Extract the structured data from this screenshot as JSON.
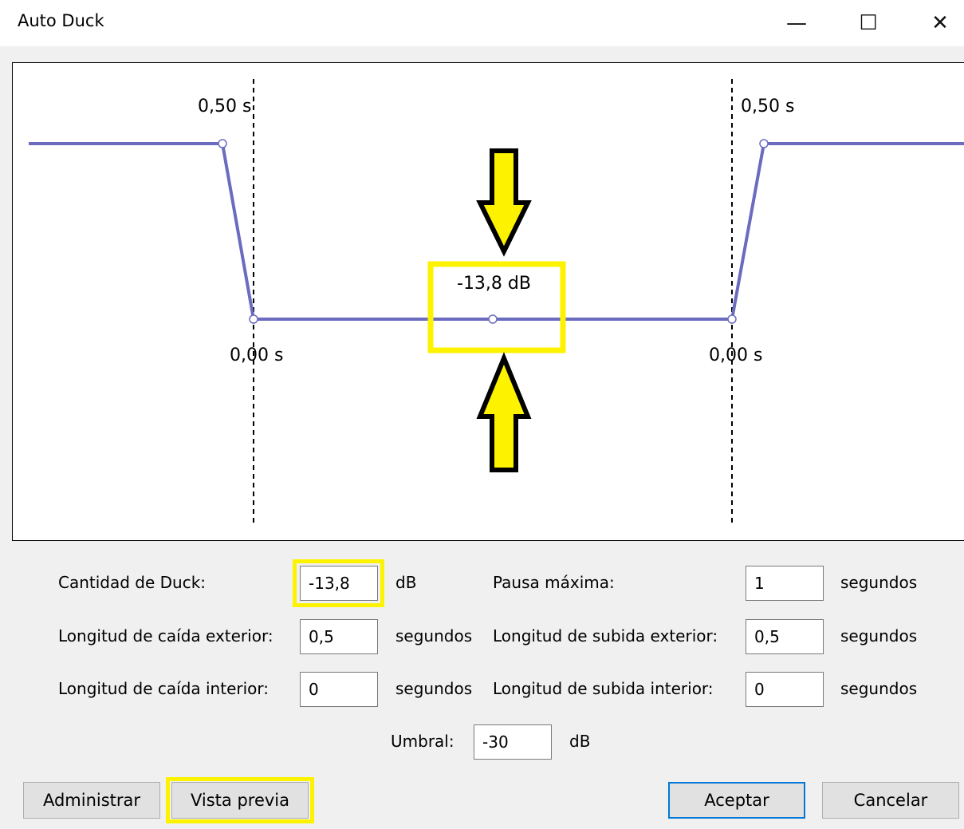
{
  "window": {
    "title": "Auto Duck",
    "minimize_glyph": "—",
    "maximize_glyph": "☐",
    "close_glyph": "✕"
  },
  "graph": {
    "outer_fade_down_label": "0,50 s",
    "inner_fade_down_label": "0,00 s",
    "outer_fade_up_label": "0,50 s",
    "inner_fade_up_label": "0,00 s",
    "duck_level_label": "-13,8 dB",
    "line_color": "#6b6bc0",
    "highlight_color": "#fdf200"
  },
  "form": {
    "duck_amount": {
      "label": "Cantidad de Duck:",
      "value": "-13,8",
      "unit": "dB"
    },
    "max_pause": {
      "label": "Pausa máxima:",
      "value": "1",
      "unit": "segundos"
    },
    "outer_fade_down": {
      "label": "Longitud de caída exterior:",
      "value": "0,5",
      "unit": "segundos"
    },
    "outer_fade_up": {
      "label": "Longitud de subida exterior:",
      "value": "0,5",
      "unit": "segundos"
    },
    "inner_fade_down": {
      "label": "Longitud de caída interior:",
      "value": "0",
      "unit": "segundos"
    },
    "inner_fade_up": {
      "label": "Longitud de subida interior:",
      "value": "0",
      "unit": "segundos"
    },
    "threshold": {
      "label": "Umbral:",
      "value": "-30",
      "unit": "dB"
    }
  },
  "buttons": {
    "manage": "Administrar",
    "preview": "Vista previa",
    "ok": "Aceptar",
    "cancel": "Cancelar"
  }
}
